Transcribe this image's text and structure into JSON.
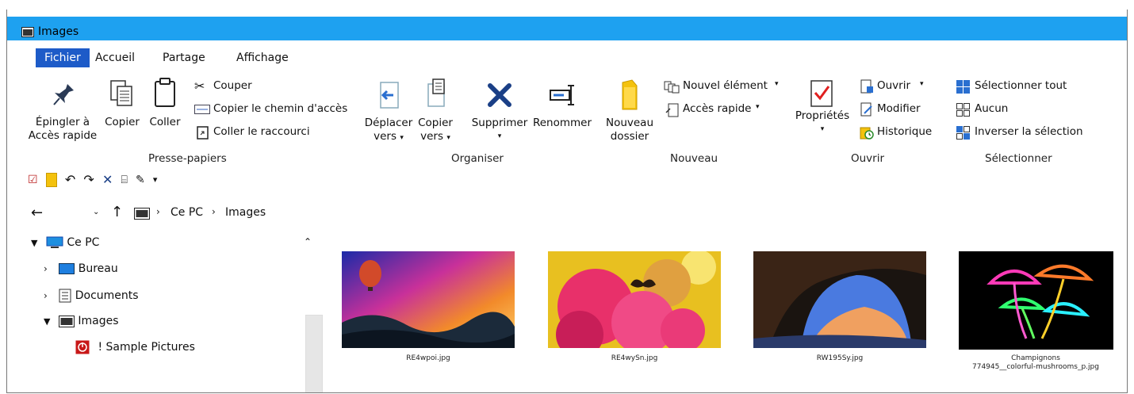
{
  "window": {
    "title": "Images"
  },
  "tabs": [
    {
      "label": "Fichier",
      "active": true
    },
    {
      "label": "Accueil"
    },
    {
      "label": "Partage"
    },
    {
      "label": "Affichage"
    }
  ],
  "ribbon": {
    "presse_papiers": {
      "group": "Presse-papiers",
      "pin_label_1": "Épingler à",
      "pin_label_2": "Accès rapide",
      "copy": "Copier",
      "paste": "Coller",
      "cut": "Couper",
      "copy_path": "Copier le chemin d'accès",
      "paste_shortcut": "Coller le raccourci"
    },
    "organiser": {
      "group": "Organiser",
      "move_1": "Déplacer",
      "move_2": "vers",
      "copyto_1": "Copier",
      "copyto_2": "vers",
      "delete": "Supprimer",
      "rename": "Renommer"
    },
    "nouveau": {
      "group": "Nouveau",
      "newfolder_1": "Nouveau",
      "newfolder_2": "dossier",
      "new_item": "Nouvel élément",
      "quick_access": "Accès rapide"
    },
    "ouvrir": {
      "group": "Ouvrir",
      "properties": "Propriétés",
      "open": "Ouvrir",
      "edit": "Modifier",
      "history": "Historique"
    },
    "selectionner": {
      "group": "Sélectionner",
      "select_all": "Sélectionner tout",
      "select_none": "Aucun",
      "invert": "Inverser la sélection"
    }
  },
  "address": {
    "segments": [
      "Ce PC",
      "Images"
    ],
    "separator": "›"
  },
  "nav": {
    "items": [
      {
        "label": "Ce PC"
      },
      {
        "label": "Bureau"
      },
      {
        "label": "Documents"
      },
      {
        "label": "Images"
      },
      {
        "label": "! Sample Pictures"
      }
    ]
  },
  "files": [
    {
      "name": "RE4wpoi.jpg"
    },
    {
      "name": "RE4wySn.jpg"
    },
    {
      "name": "RW195Sy.jpg"
    },
    {
      "name_line1": "Champignons",
      "name_line2": "774945__colorful-mushrooms_p.jpg"
    }
  ],
  "colors": {
    "titlebar": "#1ea1f0",
    "file_tab": "#1d5bc8"
  }
}
